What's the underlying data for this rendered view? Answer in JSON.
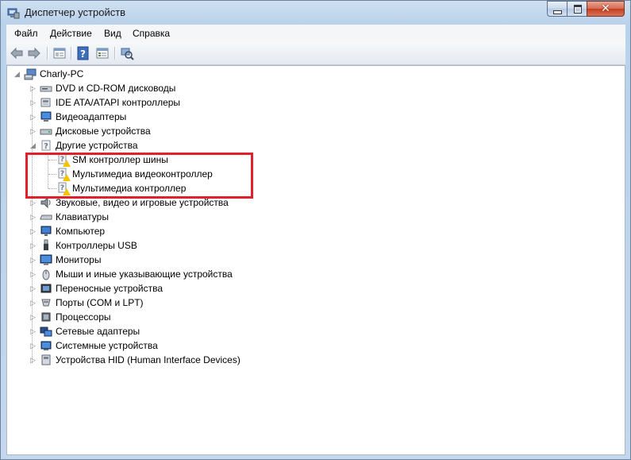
{
  "window": {
    "title": "Диспетчер устройств",
    "close_glyph": "✕"
  },
  "menu": {
    "items": [
      "Файл",
      "Действие",
      "Вид",
      "Справка"
    ]
  },
  "toolbar": {
    "icons": [
      "back-arrow-icon",
      "forward-arrow-icon",
      "properties-icon",
      "help-icon",
      "show-hidden-icon",
      "scan-hardware-icon"
    ]
  },
  "tree": {
    "root": "Charly-PC",
    "categories": [
      "DVD и CD-ROM дисководы",
      "IDE ATA/ATAPI контроллеры",
      "Видеоадаптеры",
      "Дисковые устройства",
      "Другие устройства",
      "Звуковые, видео и игровые устройства",
      "Клавиатуры",
      "Компьютер",
      "Контроллеры USB",
      "Мониторы",
      "Мыши и иные указывающие устройства",
      "Переносные устройства",
      "Порты (COM и LPT)",
      "Процессоры",
      "Сетевые адаптеры",
      "Системные устройства",
      "Устройства HID (Human Interface Devices)"
    ],
    "other_devices": [
      "SM контроллер шины",
      "Мультимедиа видеоконтроллер",
      "Мультимедиа контроллер"
    ],
    "highlight_color": "#e0202a",
    "warning_color": "#f2c500"
  }
}
